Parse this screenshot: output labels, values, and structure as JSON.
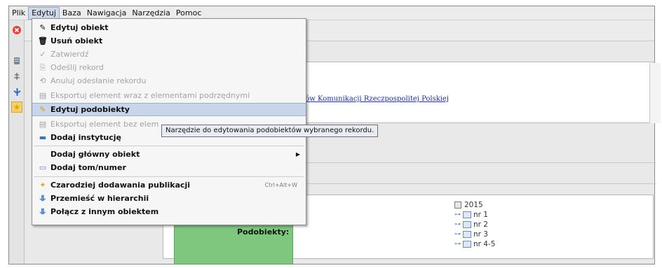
{
  "menubar": {
    "items": [
      "Plik",
      "Edytuj",
      "Baza",
      "Nawigacja",
      "Narzędzia",
      "Pomoc"
    ],
    "active_index": 1
  },
  "menu": {
    "items": [
      {
        "label": "Edytuj obiekt",
        "icon": "edit-icon",
        "state": "bold"
      },
      {
        "label": "Usuń obiekt",
        "icon": "trash-icon",
        "state": "bold"
      },
      {
        "label": "Zatwierdź",
        "icon": "check-icon",
        "state": "disabled"
      },
      {
        "label": "Odeślij rekord",
        "icon": "send-icon",
        "state": "disabled"
      },
      {
        "label": "Anuluj odesłanie rekordu",
        "icon": "cancel-send-icon",
        "state": "disabled"
      },
      {
        "label": "Eksportuj element wraz z elementami podrzędnymi",
        "icon": "export-icon",
        "state": "disabled"
      },
      {
        "label": "Edytuj podobiekty",
        "icon": "edit-subobjects-icon",
        "state": "highlighted"
      },
      {
        "label": "Eksportuj element bez elem",
        "icon": "export-icon",
        "state": "disabled"
      },
      {
        "label": "Dodaj instytucję",
        "icon": "institution-icon",
        "state": "bold"
      },
      {
        "label": "Dodaj główny obiekt",
        "icon": "",
        "state": "bold",
        "submenu": true
      },
      {
        "label": "Dodaj tom/numer",
        "icon": "book-icon",
        "state": "bold"
      },
      {
        "label": "Czarodziej dodawania publikacji",
        "icon": "wizard-icon",
        "state": "bold",
        "shortcut": "Ctrl+Alt+W"
      },
      {
        "label": "Przemieść w hierarchii",
        "icon": "hierarchy-icon",
        "state": "bold"
      },
      {
        "label": "Połącz z innym obiektem",
        "icon": "link-icon",
        "state": "bold"
      }
    ]
  },
  "tooltip": {
    "text": "Narzędzie do edytowania podobiektów wybranego rekordu."
  },
  "record": {
    "link_text": "zenie Inżynierów i Techników Komunikacji Rzeczpospolitej Polskiej"
  },
  "detail": {
    "subobjects_label": "Podobiekty:"
  },
  "tree": {
    "root": "2015",
    "children": [
      "nr 1",
      "nr 2",
      "nr 3",
      "nr 4-5"
    ]
  },
  "colors": {
    "highlight": "#c9d5ea",
    "green_cell": "#7fc77f",
    "link": "#1c2db0"
  }
}
